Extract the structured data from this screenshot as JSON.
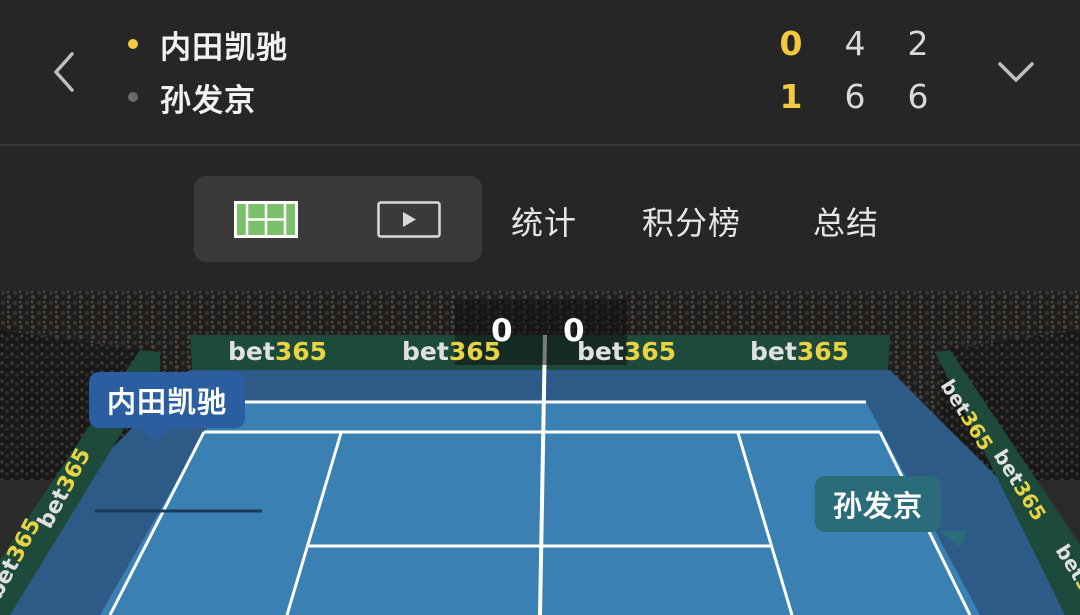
{
  "match": {
    "players": [
      {
        "name": "内田凯驰",
        "serving": true,
        "indicator_color": "#f5c842",
        "scores": [
          "0",
          "4",
          "2"
        ]
      },
      {
        "name": "孙发京",
        "serving": false,
        "indicator_color": "#6b6b6b",
        "scores": [
          "1",
          "6",
          "6"
        ]
      }
    ]
  },
  "nav": {
    "back_icon": "chevron-left-icon",
    "expand_icon": "chevron-down-icon"
  },
  "tabs": {
    "icons": [
      "court-icon",
      "video-icon"
    ],
    "stats_label": "统计",
    "standings_label": "积分榜",
    "summary_label": "总结"
  },
  "court": {
    "game_score": [
      "0",
      "0"
    ],
    "player_labels": [
      "内田凯驰",
      "孙发京"
    ],
    "sponsor": "bet365",
    "colors": {
      "court": "#3a7fb0",
      "surround": "#2d5a86",
      "banner": "#1f4a3a",
      "accent_yellow": "#e8d442"
    }
  }
}
